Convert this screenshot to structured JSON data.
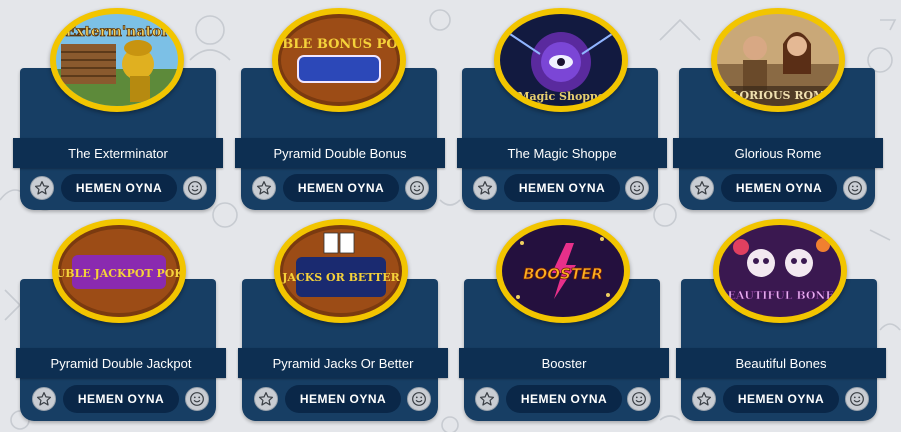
{
  "colors": {
    "page_background": "#e4e6ea",
    "card_background": "#173e64",
    "title_bar": "#0d2f52",
    "play_button": "#0a2748",
    "thumbnail_ring": "#f2c500",
    "icon_button": "#c9cdd3"
  },
  "icons": {
    "favorite": "star-icon",
    "rate": "smiley-face-icon"
  },
  "play_label": "HEMEN OYNA",
  "games": [
    {
      "title": "The Exterminator",
      "art_text": "Exterm'nator"
    },
    {
      "title": "Pyramid Double Bonus",
      "art_text": "DOUBLE BONUS POKER"
    },
    {
      "title": "The Magic Shoppe",
      "art_text": "Magic Shoppe"
    },
    {
      "title": "Glorious Rome",
      "art_text": "GLORIOUS ROME"
    },
    {
      "title": "Pyramid Double Jackpot",
      "art_text": "DOUBLE JACKPOT POKER"
    },
    {
      "title": "Pyramid Jacks Or Better",
      "art_text": "JACKS OR BETTER"
    },
    {
      "title": "Booster",
      "art_text": "BOOSTER"
    },
    {
      "title": "Beautiful Bones",
      "art_text": "BEAUTIFUL BONES"
    }
  ]
}
